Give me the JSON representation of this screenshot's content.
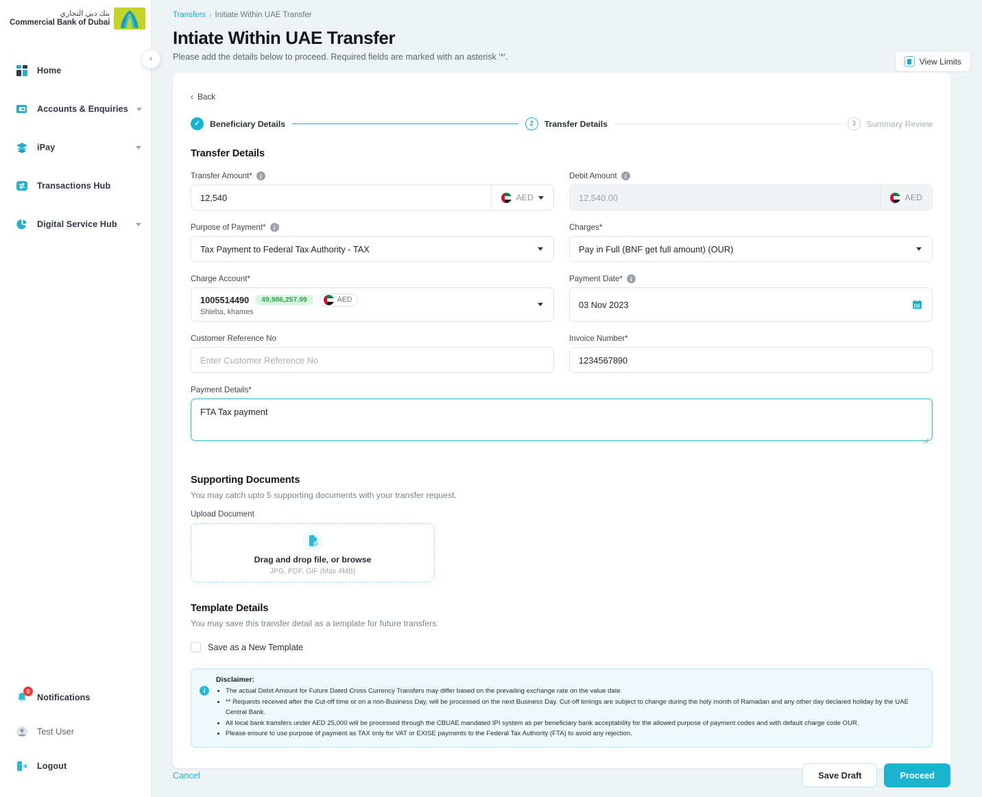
{
  "brand": {
    "arabic": "بنك دبي التجاري",
    "english": "Commercial Bank of Dubai",
    "logo_bg": "#c3d42b",
    "accent": "#1bb3ce"
  },
  "sidebar": {
    "items": [
      {
        "label": "Home",
        "icon": "grid-icon",
        "caret": false
      },
      {
        "label": "Accounts & Enquiries",
        "icon": "wallet-icon",
        "caret": true
      },
      {
        "label": "iPay",
        "icon": "layers-icon",
        "caret": true
      },
      {
        "label": "Transactions Hub",
        "icon": "exchange-icon",
        "caret": false
      },
      {
        "label": "Digital Service Hub",
        "icon": "pie-icon",
        "caret": true
      }
    ],
    "bottom": [
      {
        "label": "Notifications",
        "icon": "bell-icon",
        "badge": "0"
      },
      {
        "label": "Test User",
        "icon": "user-icon",
        "badge": null
      },
      {
        "label": "Logout",
        "icon": "logout-icon",
        "badge": null
      }
    ],
    "collapse_icon": "chevron-left-icon"
  },
  "header": {
    "breadcrumb": {
      "parent": "Transfers",
      "separator": "›",
      "current": "Initiate Within UAE Transfer"
    },
    "title": "Intiate Within UAE Transfer",
    "subtitle": "Please add the details below to proceed. Required fields are marked with an asterisk '*'.",
    "view_limits_label": "View Limits",
    "view_limits_icon": "chart-icon"
  },
  "card": {
    "back_label": "Back",
    "back_icon": "chevron-left-icon",
    "stepper": [
      {
        "num": "1",
        "label": "Beneficiary Details",
        "state": "done"
      },
      {
        "num": "2",
        "label": "Transfer Details",
        "state": "active"
      },
      {
        "num": "3",
        "label": "Summary Review",
        "state": "idle"
      }
    ],
    "section_title": "Transfer Details",
    "fields": {
      "transfer_amount": {
        "label": "Transfer Amount*",
        "value": "12,540",
        "currency": "AED",
        "has_info": true
      },
      "debit_amount": {
        "label": "Debit Amount",
        "value": "12,540.00",
        "currency": "AED",
        "has_info": true,
        "disabled": true
      },
      "purpose": {
        "label": "Purpose of Payment*",
        "value": "Tax Payment to Federal Tax Authority - TAX",
        "has_info": true
      },
      "charges": {
        "label": "Charges*",
        "value": "Pay in Full (BNF get full amount) (OUR)",
        "has_info": false
      },
      "charge_account": {
        "label": "Charge Account*",
        "account_number": "1005514490",
        "balance": "49,986,257.99",
        "currency": "AED",
        "account_name": "Shieba, khames"
      },
      "payment_date": {
        "label": "Payment Date*",
        "value": "03 Nov 2023",
        "has_info": true,
        "icon": "calendar-icon"
      },
      "customer_reference": {
        "label": "Customer Reference No",
        "value": "",
        "placeholder": "Enter Customer Reference No"
      },
      "invoice_number": {
        "label": "Invoice Number*",
        "value": "1234567890"
      },
      "payment_details": {
        "label": "Payment Details*",
        "value": "FTA Tax payment"
      }
    },
    "supporting": {
      "title": "Supporting Documents",
      "subtitle": "You may catch upto 5 supporting documents with your transfer request.",
      "upload_label": "Upload Document",
      "drop_main": "Drag and drop file, or browse",
      "drop_sub": "JPG, PDF, GIF (Max 4MB)",
      "drop_icon": "file-add-icon"
    },
    "template": {
      "title": "Template Details",
      "subtitle": "You may save this transfer detail as a template for future transfers.",
      "checkbox_label": "Save as a New Template",
      "checked": false
    },
    "disclaimer": {
      "icon": "info-icon",
      "title": "Disclaimer:",
      "items": [
        "The actual Debit Amount for Future Dated Cross Currency Transfers may differ based on the prevailing exchange rate on the value date.",
        "** Requests received after the Cut-off time or on a non-Business Day, will be processed on the next Business Day. Cut-off timings are subject to change during the holy month of Ramadan and any other day declared holiday by the UAE Central Bank.",
        "All local bank transfers under AED 25,000 will be processed through the CBUAE mandated IPI system as per beneficiary bank acceptability for the allowed purpose of payment codes and with default charge code OUR.",
        "Please ensure to use purpose of payment as TAX only for VAT or EXISE payments to the Federal Tax Authority (FTA) to avoid any rejection."
      ]
    }
  },
  "footer": {
    "cancel_label": "Cancel",
    "save_draft_label": "Save Draft",
    "proceed_label": "Proceed"
  }
}
